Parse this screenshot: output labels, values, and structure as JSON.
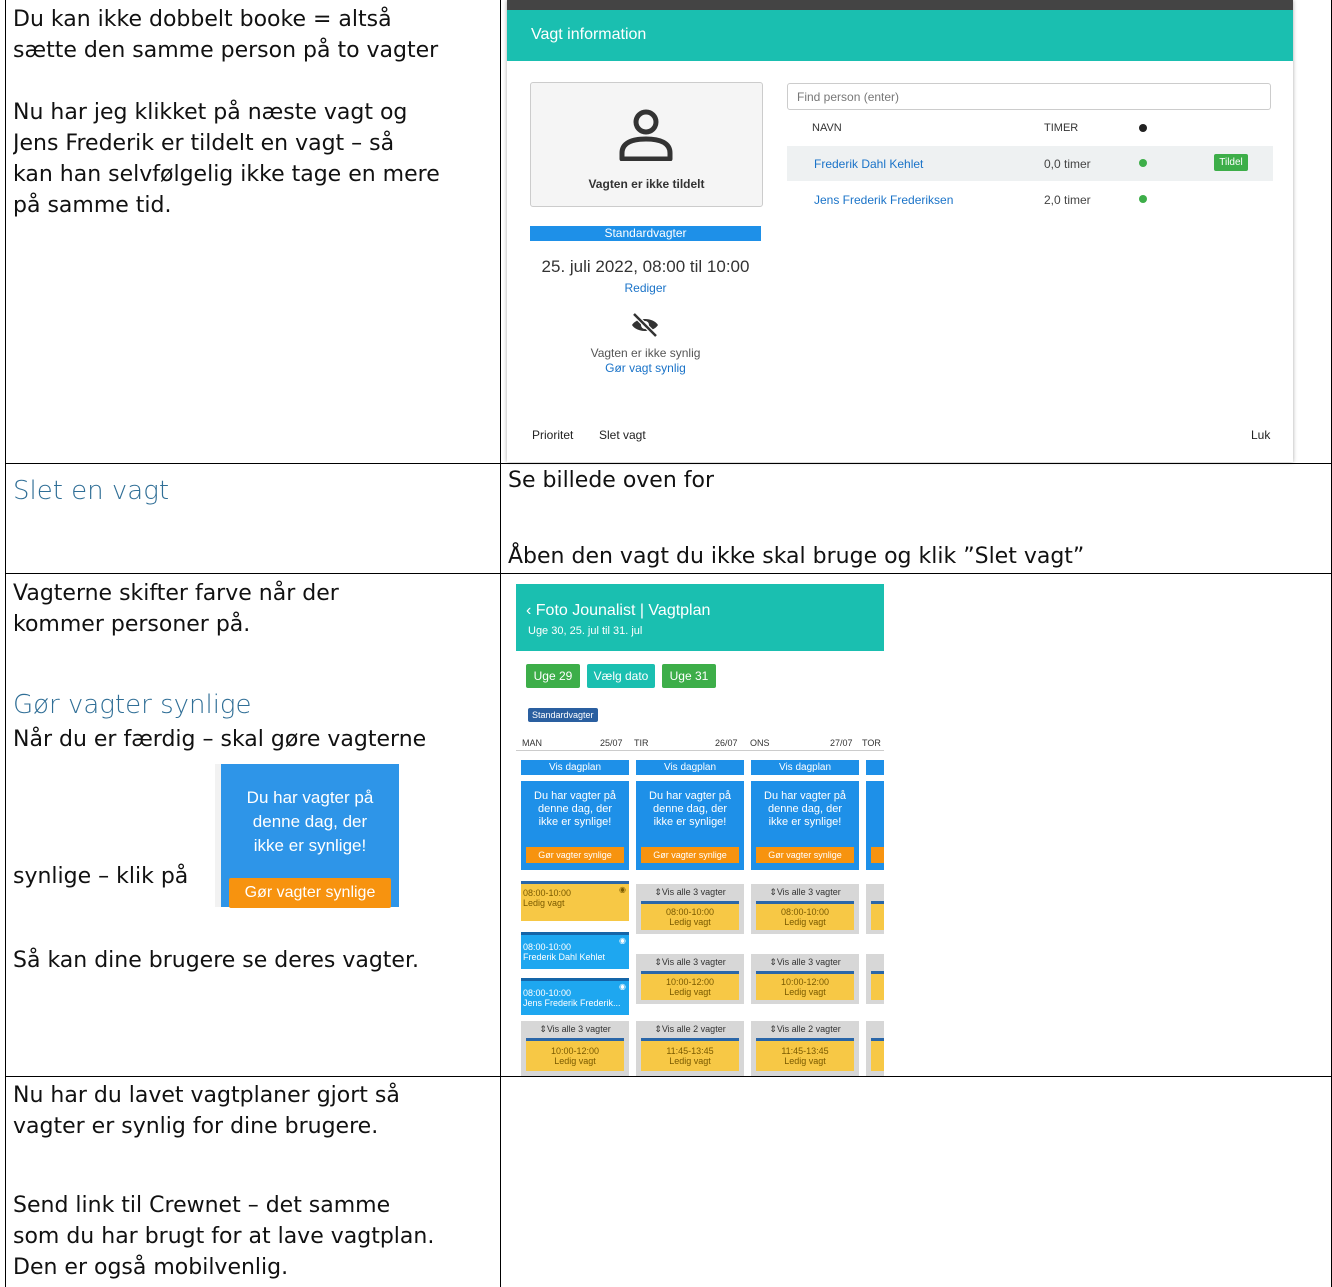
{
  "row1": {
    "left_text_1": [
      "Du kan ikke dobbelt booke = altså",
      "sætte den samme person på to vagter"
    ],
    "left_text_2": [
      "Nu har jeg klikket på næste vagt  og",
      "Jens Frederik er tildelt en vagt – så",
      "kan han selvfølgelig ikke tage en mere",
      "på samme tid."
    ]
  },
  "modal": {
    "title": "Vagt information",
    "avatar_caption": "Vagten er ikke tildelt",
    "category": "Standardvagter",
    "datetime": "25. juli 2022, 08:00 til 10:00",
    "edit_link": "Rediger",
    "hidden_text": "Vagten er ikke synlig",
    "make_visible_link": "Gør vagt synlig",
    "search_placeholder": "Find person (enter)",
    "col_name": "NAVN",
    "col_hours": "TIMER",
    "people": [
      {
        "name": "Frederik Dahl Kehlet",
        "hours": "0,0 timer",
        "action": "Tildel"
      },
      {
        "name": "Jens Frederik Frederiksen",
        "hours": "2,0 timer",
        "action": ""
      }
    ],
    "footer_priority": "Prioritet",
    "footer_delete": "Slet vagt",
    "footer_close": "Luk"
  },
  "row2": {
    "heading": "Slet en vagt",
    "right_1": "Se billede oven for",
    "right_2": "Åben den vagt du ikke skal bruge og klik ”Slet vagt”"
  },
  "row3": {
    "text_1": [
      "Vagterne skifter farve når der",
      "kommer personer på."
    ],
    "heading": "Gør vagter synlige",
    "text_2": "Når du er færdig – skal gøre vagterne",
    "text_3": "synlige – klik på",
    "text_4": "Så kan dine brugere se deres vagter."
  },
  "zoom_button": {
    "message": [
      "Du har vagter på",
      "denne dag, der",
      "ikke er synlige!"
    ],
    "button": "Gør vagter synlige"
  },
  "schedule": {
    "title": "‹ Foto Jounalist | Vagtplan",
    "subtitle": "Uge 30, 25. jul til 31. jul",
    "buttons": [
      "Uge 29",
      "Vælg dato",
      "Uge 31"
    ],
    "tag": "Standardvagter",
    "days": [
      {
        "name": "MAN",
        "date": "25/07"
      },
      {
        "name": "TIR",
        "date": "26/07"
      },
      {
        "name": "ONS",
        "date": "27/07"
      },
      {
        "name": "TOR",
        "date": ""
      }
    ],
    "vis_dagplan": "Vis dagplan",
    "warning": [
      "Du har vagter på",
      "denne dag, der",
      "ikke er synlige!"
    ],
    "warning_btn": "Gør vagter synlige",
    "mon_shifts": [
      {
        "time": "08:00-10:00",
        "label": "Ledig vagt"
      },
      {
        "time": "08:00-10:00",
        "label": "Frederik Dahl Kehlet"
      },
      {
        "time": "08:00-10:00",
        "label": "Jens Frederik Frederik..."
      }
    ],
    "show_all_3": "⇕Vis alle 3 vagter",
    "show_all_2": "⇕Vis alle 2 vagter",
    "slot_a": {
      "time": "08:00-10:00",
      "label": "Ledig vagt"
    },
    "slot_b": {
      "time": "10:00-12:00",
      "label": "Ledig vagt"
    },
    "slot_c": {
      "time": "11:45-13:45",
      "label": "Ledig vagt"
    }
  },
  "row4": {
    "text_1": [
      "Nu har du lavet vagtplaner gjort så",
      "vagter er synlig for dine brugere."
    ],
    "text_2": [
      "Send link til Crewnet – det samme",
      "som du har brugt for at lave vagtplan.",
      "Den er også mobilvenlig."
    ]
  },
  "colors": {
    "teal": "#1abfb0",
    "blue": "#1e90e8",
    "orange": "#f7930f",
    "yellow": "#f7c845",
    "green": "#3dae49"
  }
}
